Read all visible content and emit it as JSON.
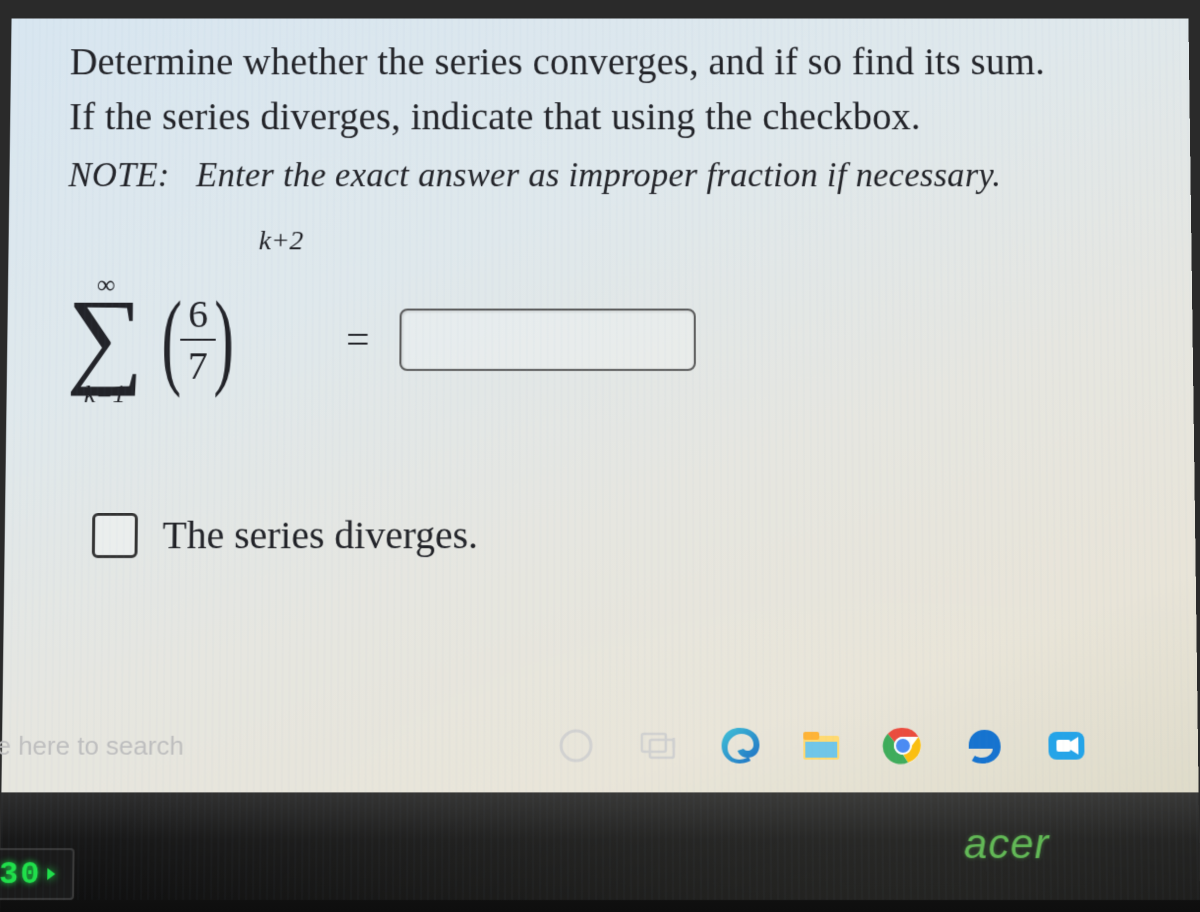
{
  "problem": {
    "line1": "Determine whether the series converges, and if so find its sum.",
    "line2": "If the series diverges, indicate that using the checkbox."
  },
  "note": {
    "label": "NOTE:",
    "body": "Enter the exact answer as improper fraction if necessary."
  },
  "equation": {
    "sigma_upper": "∞",
    "sigma_lower": "k=1",
    "frac_num": "6",
    "frac_den": "7",
    "exponent": "k+2",
    "equals": "=",
    "answer_value": ""
  },
  "checkbox": {
    "label": "The series diverges.",
    "checked": false
  },
  "taskbar": {
    "search_placeholder": "pe here to search"
  },
  "branding": {
    "laptop": "acer",
    "led": "30"
  }
}
